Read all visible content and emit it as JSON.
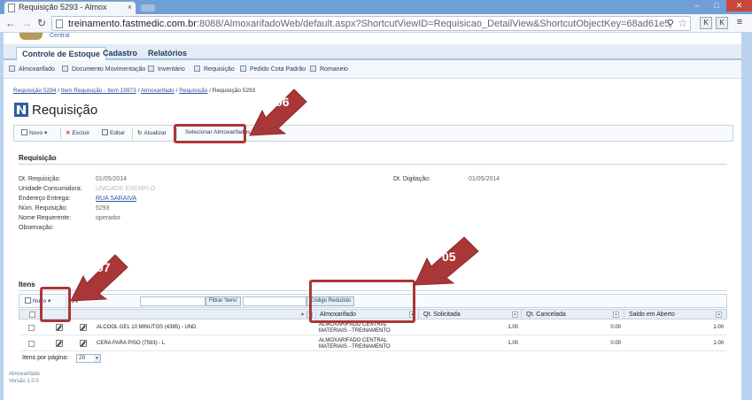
{
  "browser": {
    "tab_title": "Requisição 5293 - Almox",
    "tab_close": "×",
    "url_host": "treinamento.fastmedic.com.br",
    "url_rest": ":8088/AlmoxarifadoWeb/default.aspx?ShortcutViewID=Requisicao_DetailView&ShortcutObjectKey=68ad61e5-68a2-4b42-b451-",
    "controls": {
      "minimize": "–",
      "maximize": "□",
      "close": "✕"
    },
    "ext1": "K",
    "ext2": "K",
    "menu": "≡"
  },
  "app": {
    "logo_text": "Central",
    "tabs": [
      "Controle de Estoque",
      "Cadastro",
      "Relatórios"
    ],
    "subnav": [
      "Almoxarifado",
      "Documento Movimentação",
      "Inventário",
      "Requisição",
      "Pedido Cota Padrão",
      "Romaneio"
    ]
  },
  "breadcrumb": {
    "links": [
      "Requisição 5294",
      "Item Requisição - Item 19973",
      "Almoxarifado",
      "Requisição"
    ],
    "sep": " / ",
    "current": "Requisição 5293"
  },
  "page_title": "Requisição",
  "actions": {
    "novo": "Novo",
    "excluir": "Excluir",
    "editar": "Editar",
    "atualizar": "Atualizar",
    "selecionar": "Selecionar Almoxarifados"
  },
  "requisicao": {
    "section": "Requisição",
    "fields": [
      {
        "label": "Dt. Requisição:",
        "value": "01/05/2014"
      },
      {
        "label": "Unidade Consumidora:",
        "value": "UNIDADE EXEMPLO"
      },
      {
        "label": "Endereço Entrega:",
        "value": "RUA SARAIVA"
      },
      {
        "label": "Núm. Requisição:",
        "value": "5293"
      },
      {
        "label": "Nome Requerente:",
        "value": "operador"
      },
      {
        "label": "Observação:",
        "value": ""
      }
    ],
    "dt_digitacao_label": "Dt. Digitação:",
    "dt_digitacao_value": "01/05/2014"
  },
  "itens": {
    "section": "Itens",
    "novo": "Novo",
    "filter_btn": "Filtrar 'Itens'",
    "codigo_btn": "Código Reduzido",
    "columns": [
      "Almoxarifado",
      "Qt. Solicitada",
      "Qt. Cancelada",
      "Saldo em Aberto"
    ],
    "rows": [
      {
        "item": "ALCOOL GEL 10 MINUTOS (4385) - UND",
        "almox_1": "ALMOXARIFADO CENTRAL",
        "almox_2": "MATERIAIS - TREINAMENTO",
        "solicitada": "1.00",
        "cancelada": "0.00",
        "saldo": "1.00"
      },
      {
        "item": "CERA PARA PISO (7593) - L",
        "almox_1": "ALMOXARIFADO CENTRAL",
        "almox_2": "MATERIAIS - TREINAMENTO",
        "solicitada": "1.00",
        "cancelada": "0.00",
        "saldo": "1.00"
      }
    ],
    "per_page_label": "Itens por página:",
    "per_page_value": "20"
  },
  "footer": {
    "line1": "Almoxarifado",
    "line2": "Versão 1.0.0"
  },
  "annotations": {
    "a06": "06",
    "a07": "07",
    "a05": "05",
    "color": "#a93737"
  }
}
